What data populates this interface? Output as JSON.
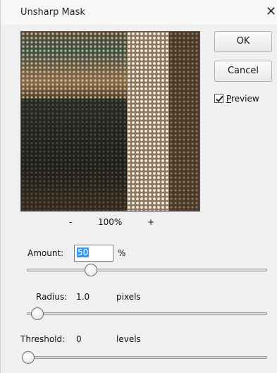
{
  "window": {
    "title": "Unsharp Mask"
  },
  "preview": {
    "zoom_minus": "-",
    "zoom_value": "100%",
    "zoom_plus": "+"
  },
  "buttons": {
    "ok": "OK",
    "cancel": "Cancel"
  },
  "preview_toggle": {
    "label_accel": "P",
    "label_rest": "review",
    "checked": true
  },
  "amount": {
    "label": "Amount:",
    "value": "50",
    "unit": "%",
    "slider_fraction": 0.27
  },
  "radius": {
    "label": "Radius:",
    "value": "1.0",
    "unit": "pixels",
    "slider_fraction": 0.04
  },
  "threshold": {
    "label": "Threshold:",
    "value": "0",
    "unit": "levels",
    "slider_fraction": 0.0
  },
  "icons": {
    "close": "close-icon",
    "check": "checkmark-icon"
  }
}
